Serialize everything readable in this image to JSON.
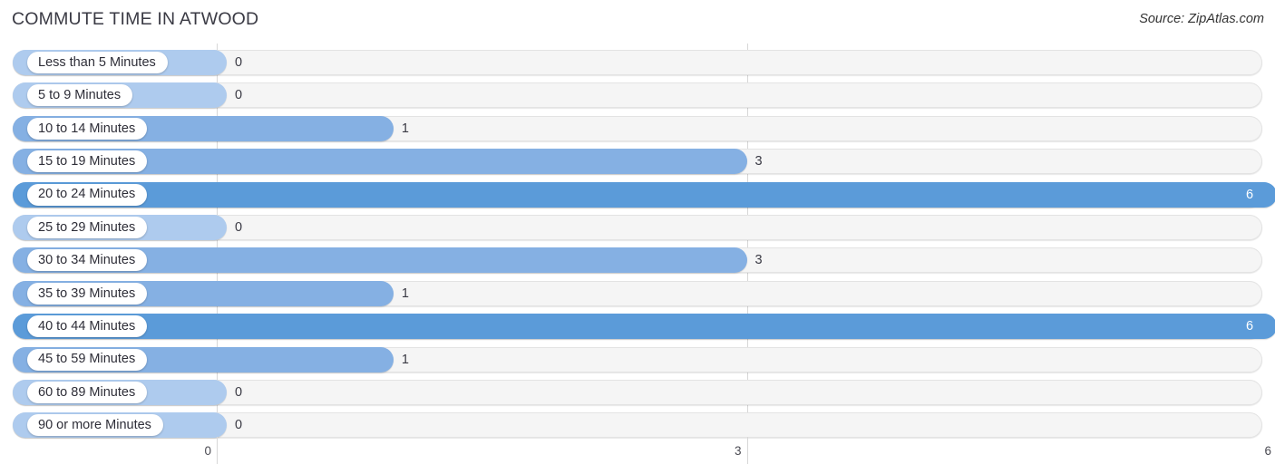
{
  "header": {
    "title": "COMMUTE TIME IN ATWOOD",
    "source": "Source: ZipAtlas.com"
  },
  "chart_data": {
    "type": "bar",
    "orientation": "horizontal",
    "title": "COMMUTE TIME IN ATWOOD",
    "xlabel": "",
    "ylabel": "",
    "xlim": [
      0,
      6
    ],
    "grid": true,
    "legend": false,
    "axis_ticks": [
      {
        "label": "0",
        "value": 0
      },
      {
        "label": "3",
        "value": 3
      },
      {
        "label": "6",
        "value": 6
      }
    ],
    "categories": [
      "Less than 5 Minutes",
      "5 to 9 Minutes",
      "10 to 14 Minutes",
      "15 to 19 Minutes",
      "20 to 24 Minutes",
      "25 to 29 Minutes",
      "30 to 34 Minutes",
      "35 to 39 Minutes",
      "40 to 44 Minutes",
      "45 to 59 Minutes",
      "60 to 89 Minutes",
      "90 or more Minutes"
    ],
    "values": [
      0,
      0,
      1,
      3,
      6,
      0,
      3,
      1,
      6,
      1,
      0,
      0
    ],
    "value_labels": [
      "0",
      "0",
      "1",
      "3",
      "6",
      "0",
      "3",
      "1",
      "6",
      "1",
      "0",
      "0"
    ]
  },
  "colors": {
    "bar_low": "#aecbee",
    "bar_mid": "#85b0e3",
    "bar_high": "#5b9bd9",
    "track": "#f5f5f5",
    "gridline": "#d8d8d8",
    "value_text": "#3a3a44",
    "value_text_inside": "#ffffff"
  }
}
